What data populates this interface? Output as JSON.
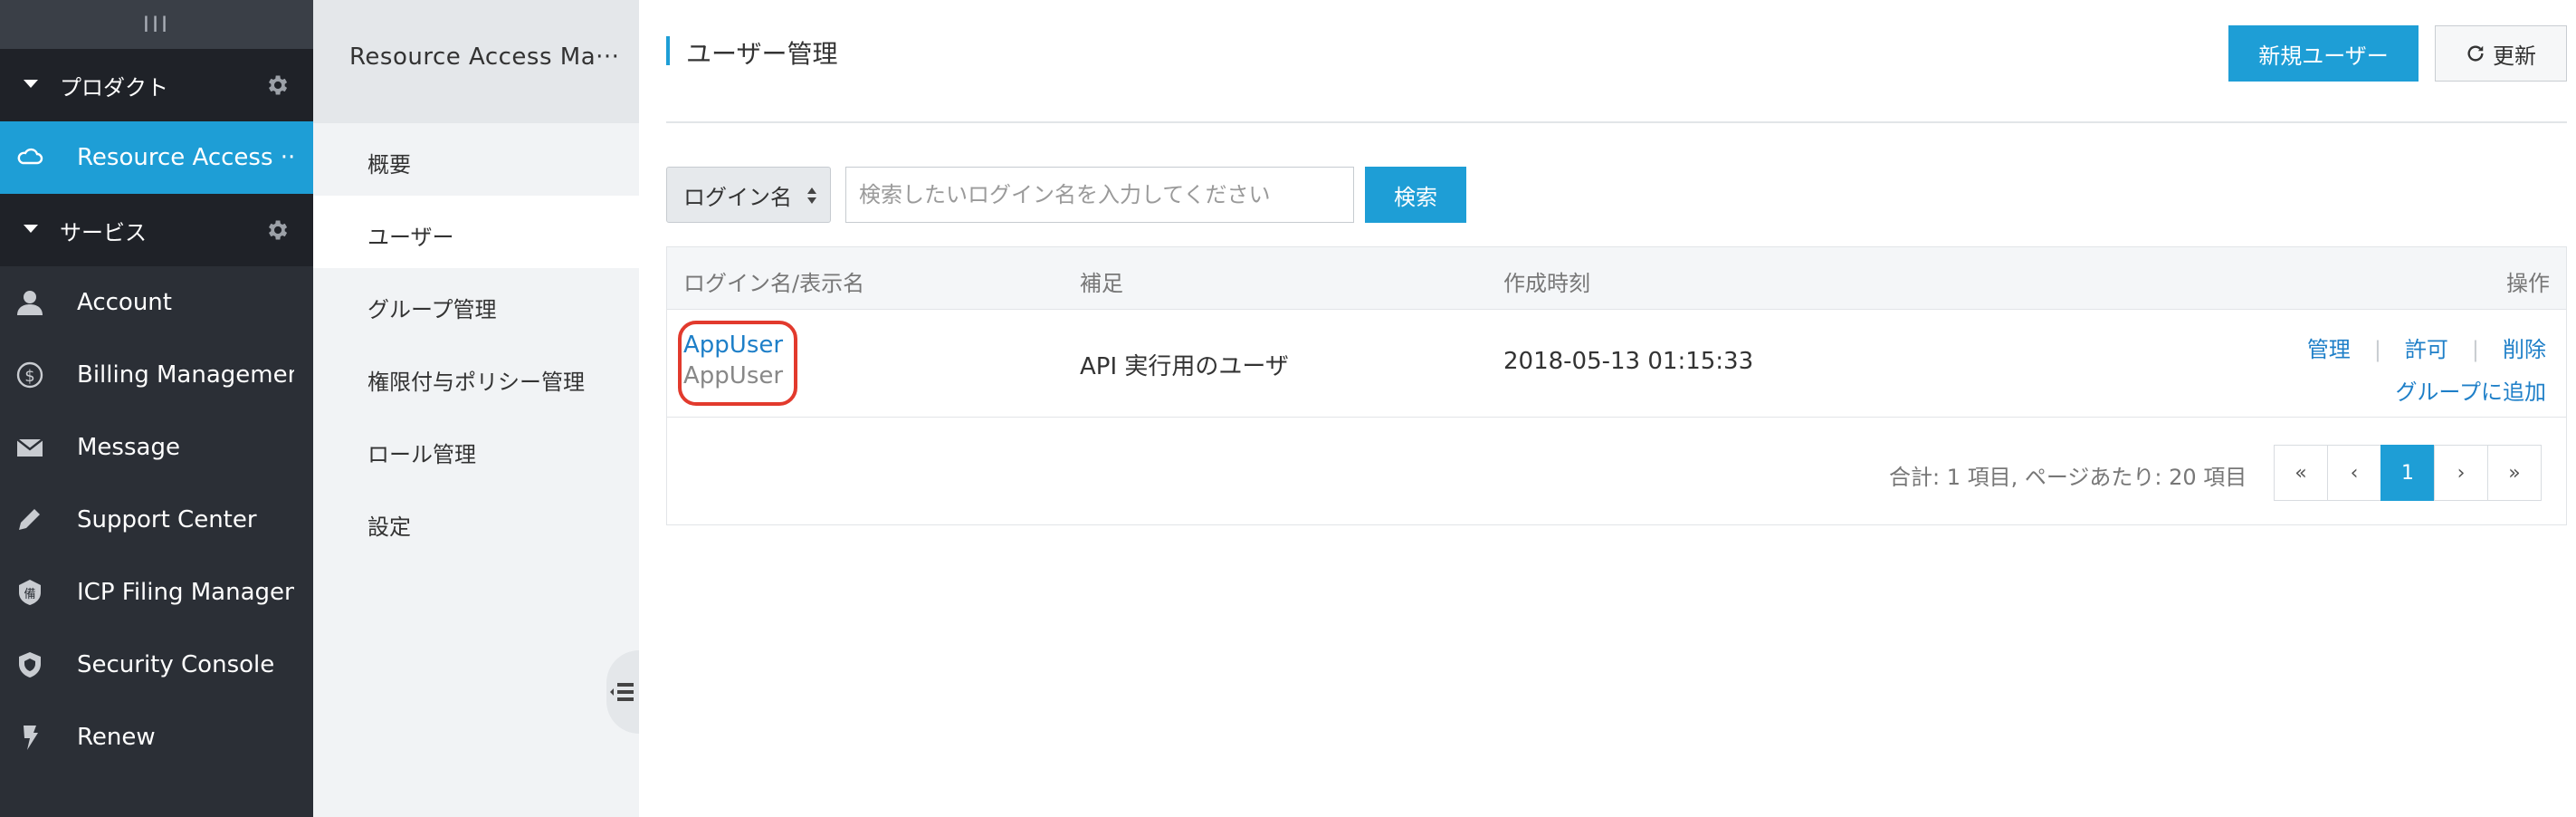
{
  "nav": {
    "handle": "III",
    "products_section": "プロダクト",
    "resource_access": "Resource Access ···",
    "services_section": "サービス",
    "items": [
      {
        "label": "Account",
        "icon": "user-icon"
      },
      {
        "label": "Billing Management",
        "icon": "dollar-icon"
      },
      {
        "label": "Message",
        "icon": "mail-icon"
      },
      {
        "label": "Support Center",
        "icon": "pencil-icon"
      },
      {
        "label": "ICP Filing Managem···",
        "icon": "icp-badge-icon"
      },
      {
        "label": "Security Console",
        "icon": "shield-icon"
      },
      {
        "label": "Renew",
        "icon": "renew-icon"
      }
    ]
  },
  "sidebar": {
    "title": "Resource Access Ma···",
    "items": [
      {
        "label": "概要",
        "active": false
      },
      {
        "label": "ユーザー",
        "active": true
      },
      {
        "label": "グループ管理",
        "active": false
      },
      {
        "label": "権限付与ポリシー管理",
        "active": false
      },
      {
        "label": "ロール管理",
        "active": false
      },
      {
        "label": "設定",
        "active": false
      }
    ]
  },
  "header": {
    "title": "ユーザー管理",
    "new_user_label": "新規ユーザー",
    "refresh_label": "更新"
  },
  "search": {
    "field_select": "ログイン名",
    "placeholder": "検索したいログイン名を入力してください",
    "button_label": "検索"
  },
  "table": {
    "columns": [
      "ログイン名/表示名",
      "補足",
      "作成時刻",
      "操作"
    ],
    "rows": [
      {
        "login_name": "AppUser",
        "display_name": "AppUser",
        "note": "API 実行用のユーザ",
        "created": "2018-05-13 01:15:33",
        "actions": [
          "管理",
          "許可",
          "削除",
          "グループに追加"
        ]
      }
    ]
  },
  "pagination": {
    "summary": "合計: 1 項目, ページあたり: 20 項目",
    "first": "«",
    "prev": "‹",
    "current": "1",
    "next": "›",
    "last": "»"
  },
  "colors": {
    "accent": "#1e9ed6",
    "nav_bg": "#2b2f36",
    "highlight": "#e23a2d"
  }
}
